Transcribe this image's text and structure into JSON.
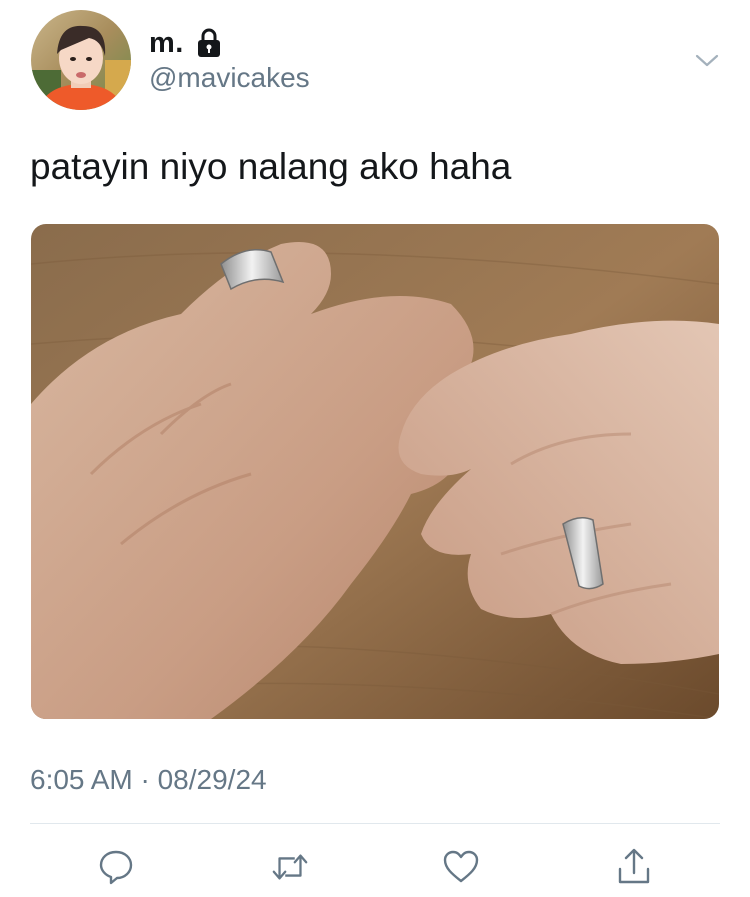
{
  "user": {
    "display_name": "m.",
    "handle": "@mavicakes",
    "avatar_icon": "profile-photo",
    "protected_icon": "lock-icon"
  },
  "tweet": {
    "text": "patayin niyo nalang ako haha",
    "media_description_icon": "photo-hands-with-rings",
    "timestamp": "6:05 AM · 08/29/24"
  },
  "actions": {
    "reply_icon": "reply-icon",
    "retweet_icon": "retweet-icon",
    "like_icon": "heart-icon",
    "share_icon": "share-icon"
  },
  "colors": {
    "primary_text": "#14171a",
    "secondary_text": "#657786",
    "divider": "#e1e8ed"
  }
}
